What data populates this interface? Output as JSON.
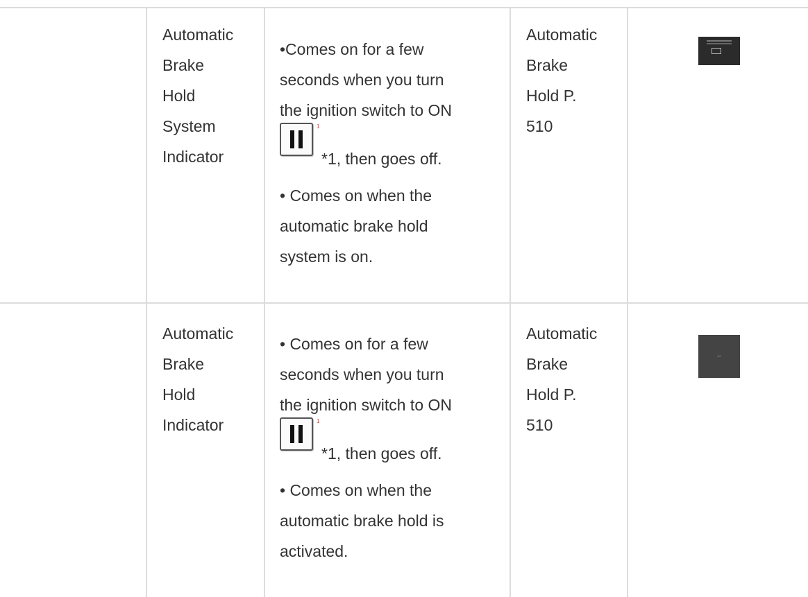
{
  "rows": [
    {
      "name_lines": [
        "Automatic",
        "Brake",
        "Hold",
        "System",
        "Indicator"
      ],
      "desc_line1": "•Comes on for a few",
      "desc_line2": "seconds when you turn",
      "desc_line3": "the ignition switch to ON",
      "footnote_mark": "1",
      "after_icon": "*1, then goes off.",
      "desc2_line1": "• Comes on when the",
      "desc2_line2": "automatic brake hold",
      "desc2_line3": "system is on.",
      "ref_lines": [
        "Automatic",
        "Brake",
        "Hold P.",
        "510"
      ],
      "thumb_icon": "brake-hold-system-standby-display-icon"
    },
    {
      "name_lines": [
        "Automatic",
        "Brake",
        "Hold",
        "Indicator"
      ],
      "desc_line1": "• Comes on for a few",
      "desc_line2": "seconds when you turn",
      "desc_line3": "the ignition switch to ON",
      "footnote_mark": "1",
      "after_icon": "*1, then goes off.",
      "desc2_line1": "• Comes on when the",
      "desc2_line2": "automatic brake hold is",
      "desc2_line3": "activated.",
      "ref_lines": [
        "Automatic",
        "Brake",
        "Hold P.",
        "510"
      ],
      "thumb_icon": "brake-hold-indicator-display-icon"
    }
  ],
  "icons": {
    "ignition_switch": "ignition-on-switch-icon"
  }
}
